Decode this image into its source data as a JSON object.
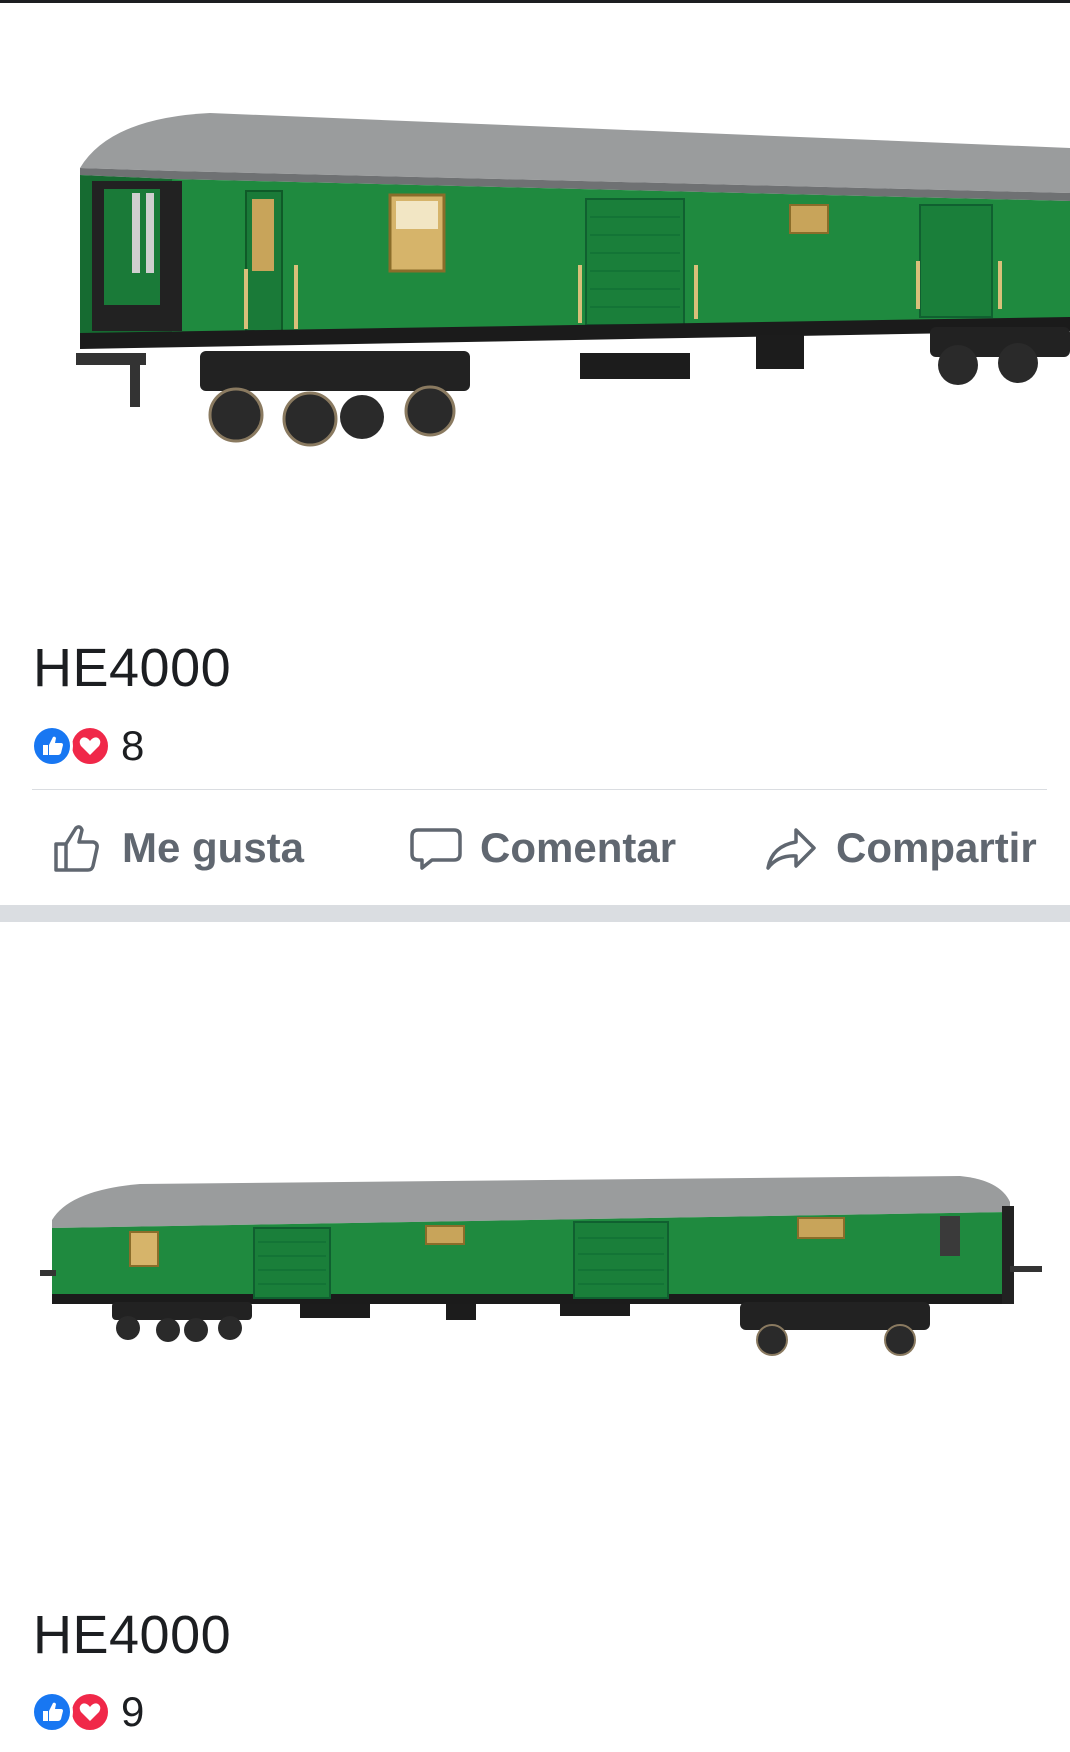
{
  "colors": {
    "like_blue": "#1877f2",
    "love_red": "#f02849",
    "action_gray": "#606770",
    "separator": "#dadde1",
    "coach_green": "#1f8a3f",
    "roof_gray": "#9a9c9d"
  },
  "posts": [
    {
      "caption": "HE4000",
      "reaction_count": "8",
      "reaction_icons": [
        "like-icon",
        "love-icon"
      ],
      "actions": {
        "like": "Me gusta",
        "comment": "Comentar",
        "share": "Compartir"
      }
    },
    {
      "caption": "HE4000",
      "reaction_count": "9",
      "reaction_icons": [
        "like-icon",
        "love-icon"
      ]
    }
  ]
}
